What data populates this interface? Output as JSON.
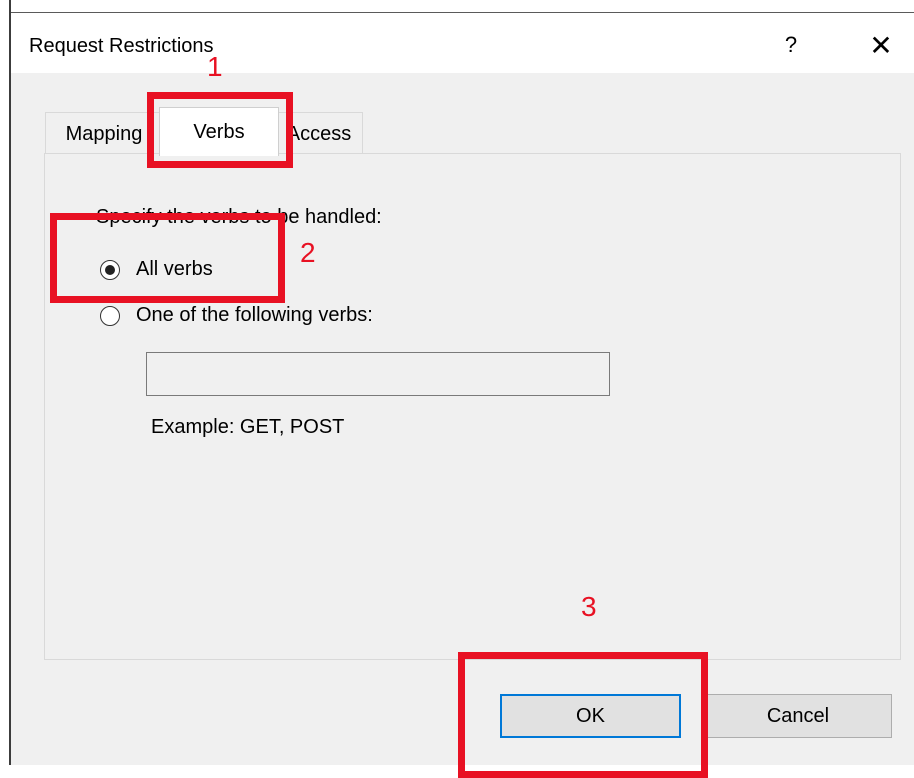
{
  "window": {
    "title": "Request Restrictions",
    "help_label": "?",
    "close_label": "✕"
  },
  "tabs": [
    {
      "label": "Mapping",
      "selected": false
    },
    {
      "label": "Verbs",
      "selected": true
    },
    {
      "label": "Access",
      "selected": false
    }
  ],
  "verbs_tab": {
    "heading": "Specify the verbs to be handled:",
    "options": [
      {
        "label": "All verbs",
        "checked": true
      },
      {
        "label": "One of the following verbs:",
        "checked": false
      }
    ],
    "verbs_input_value": "",
    "example_text": "Example: GET, POST"
  },
  "buttons": {
    "ok_label": "OK",
    "cancel_label": "Cancel"
  },
  "annotations": {
    "step1": "1",
    "step2": "2",
    "step3": "3",
    "color": "#e81123"
  },
  "colors": {
    "dialog_bg": "#f0f0f0",
    "focus_border": "#0078d7"
  }
}
